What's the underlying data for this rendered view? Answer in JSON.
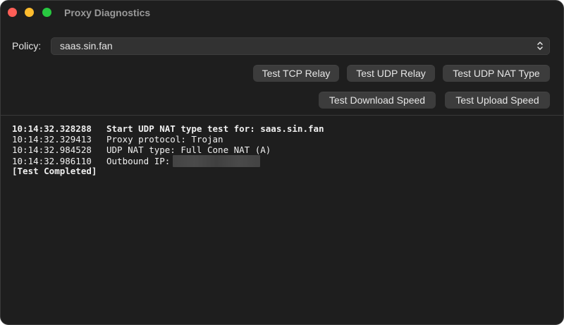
{
  "window": {
    "title": "Proxy Diagnostics"
  },
  "policy": {
    "label": "Policy:",
    "selected": "saas.sin.fan",
    "icon": "chevron-up-down-icon"
  },
  "buttons": {
    "test_tcp_relay": "Test TCP Relay",
    "test_udp_relay": "Test UDP Relay",
    "test_udp_nat_type": "Test UDP NAT Type",
    "test_download_speed": "Test Download Speed",
    "test_upload_speed": "Test Upload Speed"
  },
  "log": {
    "lines": [
      {
        "time": "10:14:32.328288",
        "message": "Start UDP NAT type test for: saas.sin.fan",
        "bold": true
      },
      {
        "time": "10:14:32.329413",
        "message": "Proxy protocol: Trojan",
        "bold": false
      },
      {
        "time": "10:14:32.984528",
        "message": "UDP NAT type: Full Cone NAT (A)",
        "bold": false
      },
      {
        "time": "10:14:32.986110",
        "message": "Outbound IP:",
        "bold": false,
        "redacted": true
      }
    ],
    "footer": "[Test Completed]"
  },
  "colors": {
    "close": "#fe5f57",
    "minimize": "#febc2e",
    "zoom": "#28c840",
    "background": "#1e1e1e",
    "button": "#3c3c3c"
  }
}
